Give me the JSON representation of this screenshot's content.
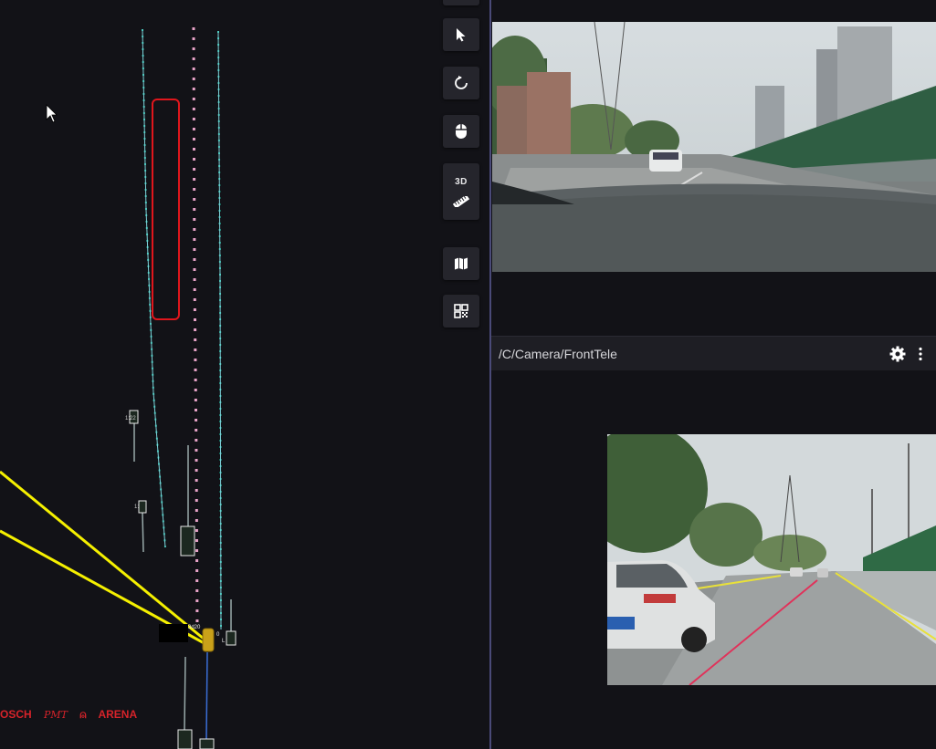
{
  "scene3d": {
    "brand": {
      "bosch": "OSCH",
      "pmt": "PMT",
      "arena": "ARENA"
    },
    "labels": {
      "obj_a": "1:22",
      "obj_b": "1:",
      "ego_a": "3d20",
      "ego_b": "0",
      "ego_c": "L"
    },
    "colors": {
      "lane_teal": "#1fbfa4",
      "lane_pink": "#e8a3c8",
      "box_red": "#e0161c",
      "ray_yellow": "#f5f000",
      "brand_red": "#d5232a"
    }
  },
  "toolbar": {
    "select_icon": "cursor-arrow-icon",
    "rotate_icon": "rotate-icon",
    "mouse_icon": "mouse-icon",
    "view3d_label": "3D",
    "ruler_icon": "ruler-icon",
    "map_icon": "map-icon",
    "qr_icon": "qr-code-icon"
  },
  "camera_panel": {
    "title": "/C/Camera/FrontTele",
    "settings_icon": "gear-icon",
    "menu_icon": "more-vertical-icon"
  }
}
